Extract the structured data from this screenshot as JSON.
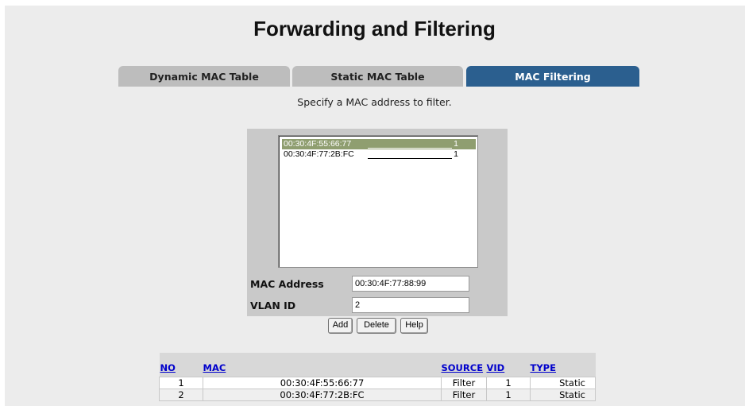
{
  "page_title": "Forwarding and Filtering",
  "tabs": [
    {
      "label": "Dynamic MAC Table",
      "active": false
    },
    {
      "label": "Static MAC Table",
      "active": false
    },
    {
      "label": "MAC Filtering",
      "active": true
    }
  ],
  "hint": "Specify a MAC address to filter.",
  "filter_list": [
    {
      "mac": "00:30:4F:55:66:77",
      "vid": "1",
      "selected": true
    },
    {
      "mac": "00:30:4F:77:2B:FC",
      "vid": "1",
      "selected": false
    }
  ],
  "form": {
    "mac_label": "MAC Address",
    "mac_value": "00:30:4F:77:88:99",
    "vlan_label": "VLAN ID",
    "vlan_value": "2"
  },
  "buttons": {
    "add": "Add",
    "delete": "Delete",
    "help": "Help"
  },
  "table": {
    "headers": {
      "no": "NO",
      "mac": "MAC",
      "source": "SOURCE",
      "vid": "VID",
      "type": "TYPE"
    },
    "rows": [
      {
        "no": "1",
        "mac": "00:30:4F:55:66:77",
        "source": "Filter",
        "vid": "1",
        "type": "Static"
      },
      {
        "no": "2",
        "mac": "00:30:4F:77:2B:FC",
        "source": "Filter",
        "vid": "1",
        "type": "Static"
      }
    ]
  },
  "colors": {
    "active_tab": "#2b5f8f",
    "inactive_tab": "#bdbdbd",
    "selected_item": "#8f9e70",
    "link": "#0000cc"
  }
}
